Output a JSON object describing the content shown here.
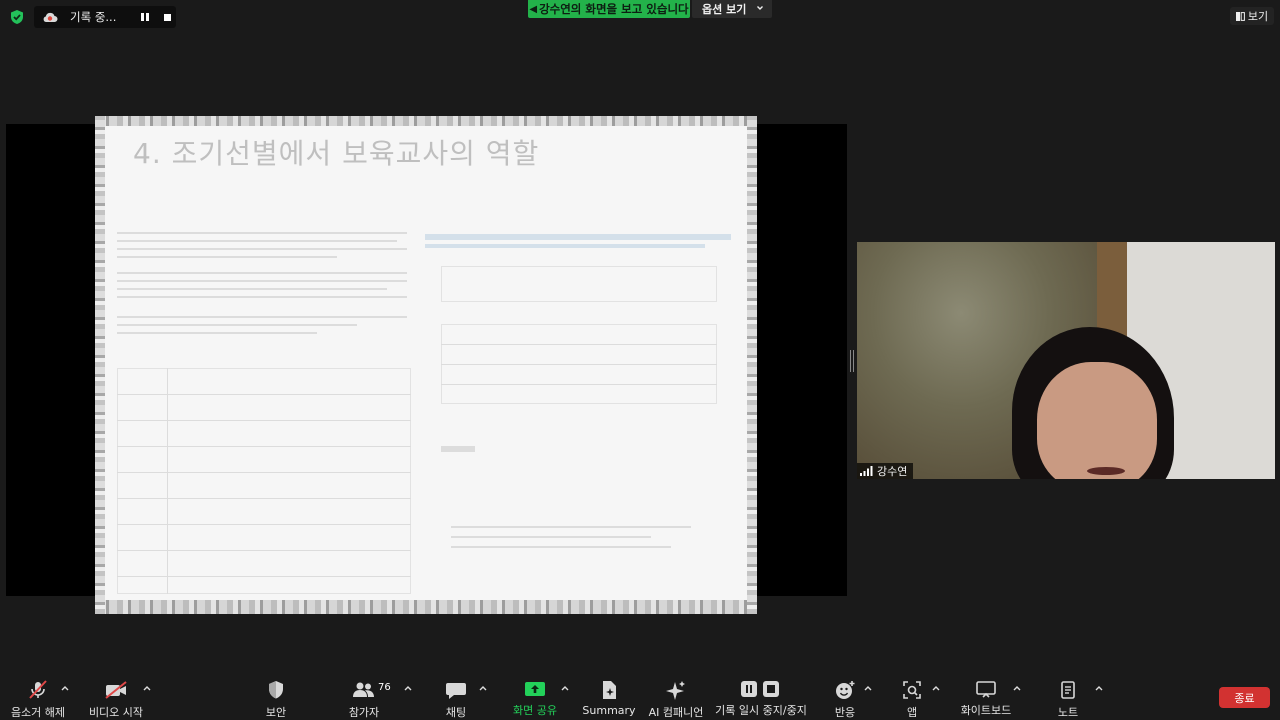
{
  "top_bar": {
    "recording_label": "기록 중...",
    "share_banner": "강수연의 화면을 보고 있습니다",
    "view_options_label": "옵션 보기",
    "view_button_label": "보기"
  },
  "shared_document": {
    "title": "4. 조기선별에서 보육교사의 역할"
  },
  "participant": {
    "name": "강수연"
  },
  "toolbar": {
    "mute": "음소거 해제",
    "video": "비디오 시작",
    "security": "보안",
    "participants": "참가자",
    "participants_count": "76",
    "chat": "채팅",
    "share": "화면 공유",
    "summary": "Summary",
    "ai_companion": "AI 컴패니언",
    "recording": "기록 일시 중지/중지",
    "reactions": "반응",
    "apps": "앱",
    "whiteboard": "화이트보드",
    "notes": "노트",
    "end": "종료"
  },
  "colors": {
    "background": "#1a1a1a",
    "share_banner": "#23b24a",
    "share_active": "#23d15a",
    "end_button": "#d23231",
    "muted_red": "#e04848"
  }
}
